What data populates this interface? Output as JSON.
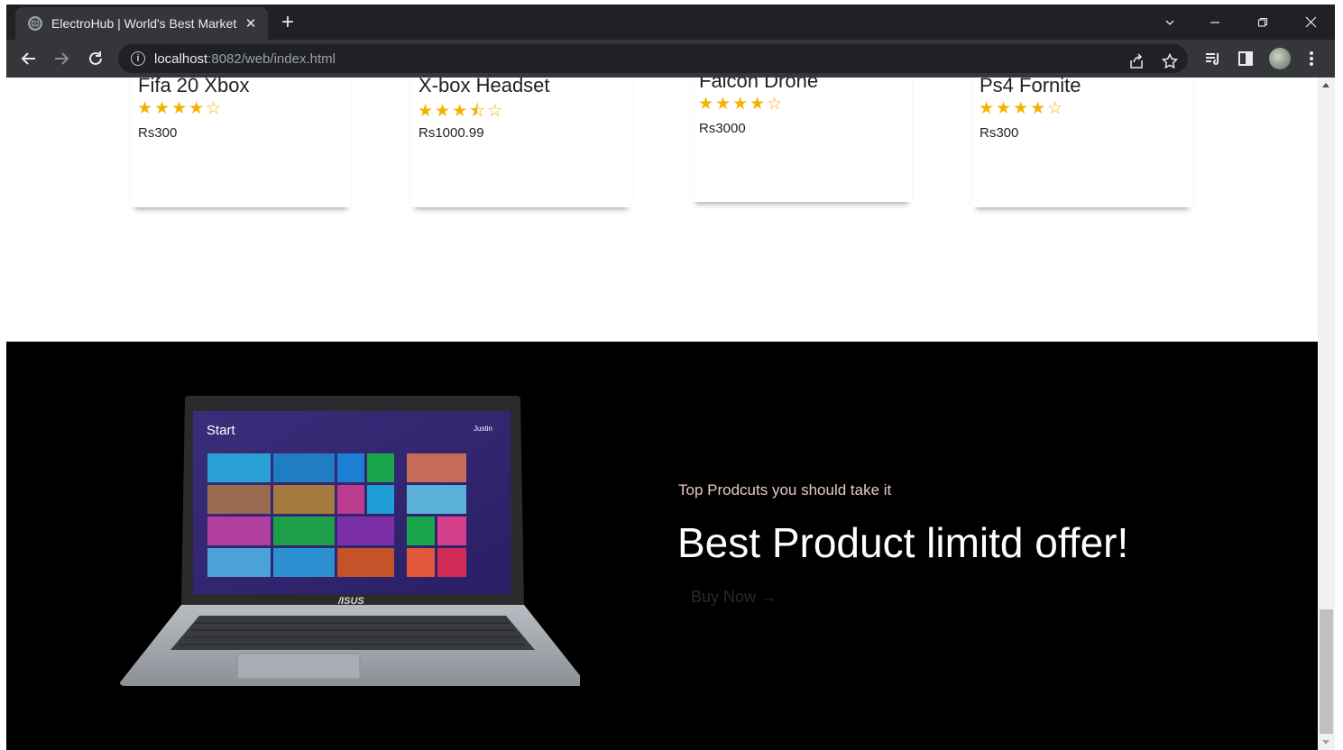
{
  "browser": {
    "tab_title": "ElectroHub | World's Best Market",
    "tab_close": "✕",
    "new_tab": "+",
    "url_host": "localhost",
    "url_rest": ":8082/web/index.html"
  },
  "products": [
    {
      "name": "Fifa 20 Xbox",
      "stars": "★★★★☆",
      "rating": 4,
      "price": "Rs300"
    },
    {
      "name": "X-box Headset",
      "stars": "★★★⯪☆",
      "rating": 3.5,
      "price": "Rs1000.99"
    },
    {
      "name": "Falcon Drone",
      "stars": "★★★★☆",
      "rating": 4,
      "price": "Rs3000"
    },
    {
      "name": "Ps4 Fornite",
      "stars": "★★★★☆",
      "rating": 4,
      "price": "Rs300"
    }
  ],
  "promo": {
    "subtitle": "Top Prodcuts you should take it",
    "title": "Best Product limitd offer!",
    "button": "Buy Now →"
  },
  "laptop": {
    "start_label": "Start",
    "user_label": "Justin",
    "brand": "/ISUS"
  },
  "colors": {
    "star": "#f5b301",
    "banner_bg": "#000000",
    "chrome_dark": "#202124",
    "chrome_toolbar": "#35363a"
  }
}
